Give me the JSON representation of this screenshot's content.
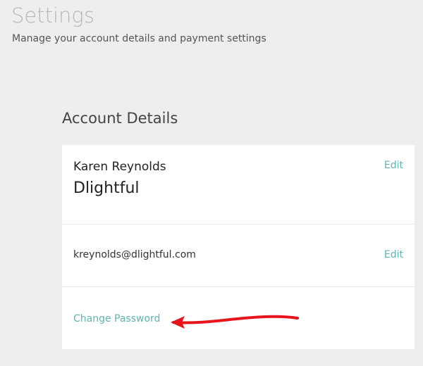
{
  "header": {
    "title": "Settings",
    "subtitle": "Manage your account details and payment settings"
  },
  "account": {
    "section_title": "Account Details",
    "name": "Karen Reynolds",
    "company": "Dlightful",
    "email": "kreynolds@dlightful.com",
    "edit_label": "Edit",
    "change_password_label": "Change Password"
  },
  "colors": {
    "background": "#eeeeee",
    "link": "#5fb3b3",
    "annotation_arrow": "#e8141c"
  },
  "icons": {
    "annotation": "red-arrow-icon"
  }
}
